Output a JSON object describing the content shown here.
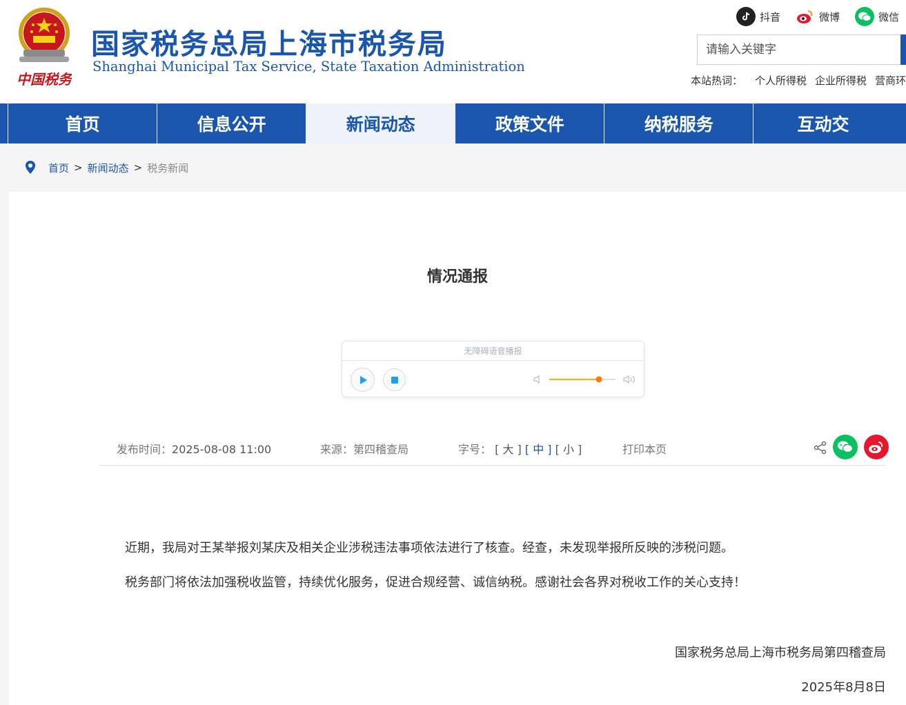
{
  "header": {
    "title": "国家税务总局上海市税务局",
    "subtitle": "Shanghai Municipal Tax Service, State Taxation Administration",
    "seal_text": "中国税务",
    "social": [
      {
        "icon": "douyin-icon",
        "label": "抖音",
        "color": "#222222"
      },
      {
        "icon": "weibo-icon",
        "label": "微博",
        "color": "#e6162d"
      },
      {
        "icon": "wechat-icon",
        "label": "微信",
        "color": "#07c160"
      }
    ],
    "search_placeholder": "请输入关键字",
    "hot_label": "本站热词：",
    "hot_words": [
      "个人所得税",
      "企业所得税",
      "营商环"
    ]
  },
  "nav": {
    "items": [
      "首页",
      "信息公开",
      "新闻动态",
      "政策文件",
      "纳税服务",
      "互动交"
    ],
    "active": "新闻动态"
  },
  "breadcrumb": {
    "icon": "location-pin-icon",
    "home": "首页",
    "sep": ">",
    "section": "新闻动态",
    "current": "税务新闻"
  },
  "article": {
    "title": "情况通报",
    "player": {
      "title": "无障碍语音播报",
      "volume": 0.75
    },
    "meta": {
      "publish_label": "发布时间：",
      "publish_time": "2025-08-08 11:00",
      "source_label": "来源：",
      "source": "第四稽查局",
      "font_label": "字号：",
      "font_sizes": [
        "[ 大 ]",
        "[ 中 ]",
        "[ 小 ]"
      ],
      "font_active": "[ 中 ]",
      "print": "打印本页"
    },
    "paragraphs": [
      "近期，我局对王某举报刘某庆及相关企业涉税违法事项依法进行了核查。经查，未发现举报所反映的涉税问题。",
      "税务部门将依法加强税收监管，持续优化服务，促进合规经营、诚信纳税。感谢社会各界对税收工作的关心支持！"
    ],
    "signature": "国家税务总局上海市税务局第四稽查局",
    "date": "2025年8月8日"
  },
  "colors": {
    "brand_blue": "#1a56ae",
    "wechat_green": "#07c160",
    "weibo_red": "#e6162d",
    "volume_orange": "#ff7a00"
  }
}
